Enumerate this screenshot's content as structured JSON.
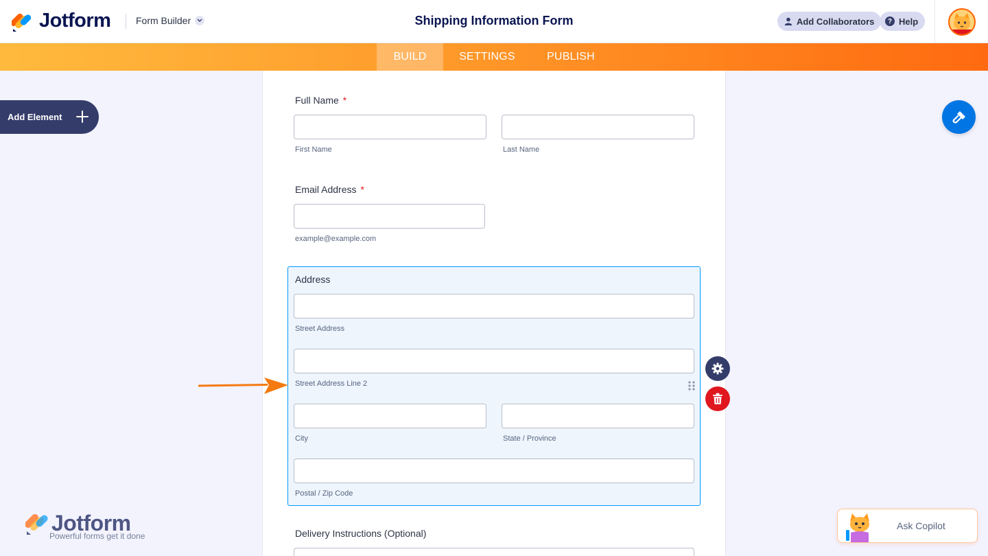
{
  "header": {
    "logo_text": "Jotform",
    "builder_label": "Form Builder",
    "form_title": "Shipping Information Form",
    "collaborators_label": "Add Collaborators",
    "help_label": "Help"
  },
  "nav": {
    "tabs": [
      {
        "label": "BUILD",
        "active": true
      },
      {
        "label": "SETTINGS",
        "active": false
      },
      {
        "label": "PUBLISH",
        "active": false
      }
    ]
  },
  "sidebar": {
    "add_element_label": "Add Element"
  },
  "form": {
    "full_name": {
      "label": "Full Name",
      "required_mark": "*",
      "first_sub": "First Name",
      "last_sub": "Last Name"
    },
    "email": {
      "label": "Email Address",
      "required_mark": "*",
      "sub": "example@example.com"
    },
    "address": {
      "label": "Address",
      "street_sub": "Street Address",
      "street2_sub": "Street Address Line 2",
      "city_sub": "City",
      "state_sub": "State / Province",
      "zip_sub": "Postal / Zip Code"
    },
    "delivery": {
      "label": "Delivery Instructions (Optional)"
    }
  },
  "footer": {
    "brand_text": "Jotform",
    "brand_tagline": "Powerful forms get it done",
    "copilot_label": "Ask Copilot"
  },
  "colors": {
    "accent_orange": "#ff6100",
    "navy": "#0a1551",
    "selection_blue": "#0099ff",
    "delete_red": "#e0171e"
  }
}
